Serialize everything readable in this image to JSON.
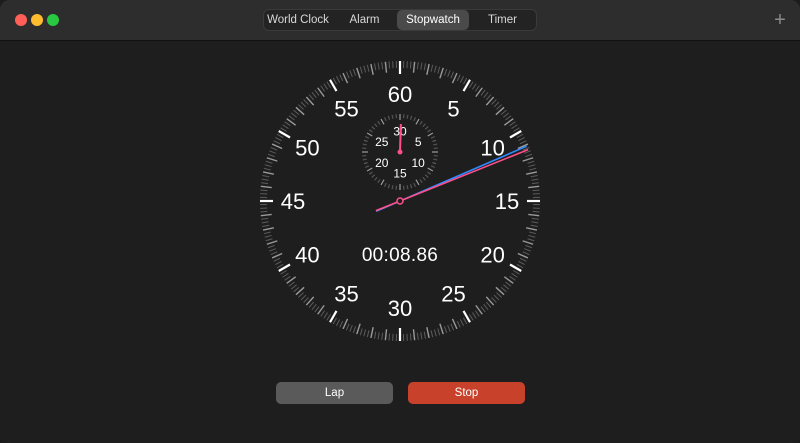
{
  "window": {
    "controls": [
      "close",
      "minimize",
      "maximize"
    ]
  },
  "tabs": [
    {
      "label": "World Clock",
      "selected": false
    },
    {
      "label": "Alarm",
      "selected": false
    },
    {
      "label": "Stopwatch",
      "selected": true
    },
    {
      "label": "Timer",
      "selected": false
    }
  ],
  "toolbar": {
    "add_icon": "plus-icon"
  },
  "stopwatch": {
    "elapsed_display": "00:08.86",
    "main_dial_labels": [
      "60",
      "5",
      "10",
      "15",
      "20",
      "25",
      "30",
      "35",
      "40",
      "45",
      "50",
      "55"
    ],
    "sub_dial_labels": [
      "30",
      "5",
      "10",
      "15",
      "20",
      "25"
    ],
    "main_hand_seconds": 8.86,
    "minute_hand_value": 0.15,
    "lap_hand_seconds": 11.1
  },
  "buttons": {
    "lap_label": "Lap",
    "stop_label": "Stop"
  },
  "colors": {
    "titlebar": "#2d2d2d",
    "background": "#1e1e1e",
    "accent_hand": "#ff4f8b",
    "lap_hand": "#2f8cff",
    "stop_button": "#c8412a",
    "lap_button": "#5a5a5a"
  }
}
